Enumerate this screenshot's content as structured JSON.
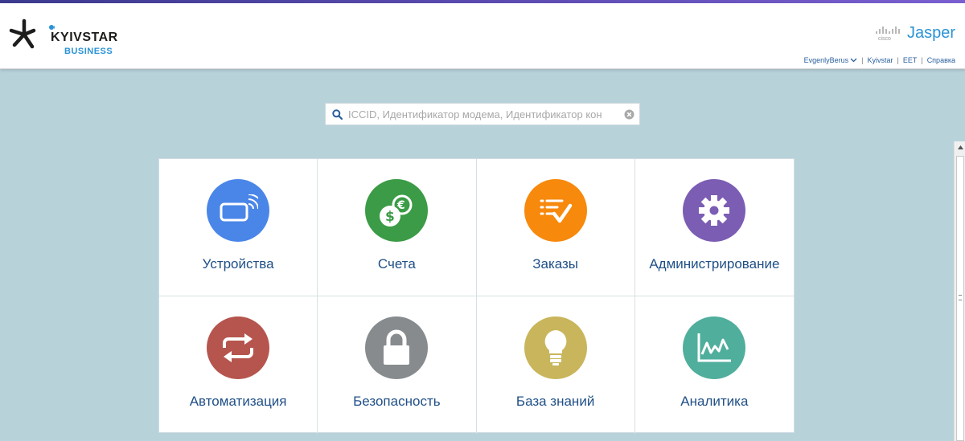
{
  "header": {
    "logo_text": "KYIVSTAR",
    "logo_sub": "BUSINESS",
    "brand_company": "cisco",
    "brand_name": "Jasper",
    "user_name": "EvgenlyBerus",
    "nav": [
      "Kyivstar",
      "EET",
      "Справка"
    ]
  },
  "search": {
    "placeholder": "ICCID, Идентификатор модема, Идентификатор кон"
  },
  "tiles": [
    {
      "label": "Устройства",
      "icon": "sim-wireless-icon",
      "color": "#4a86e8"
    },
    {
      "label": "Счета",
      "icon": "coins-icon",
      "color": "#3b9b46"
    },
    {
      "label": "Заказы",
      "icon": "checklist-icon",
      "color": "#f7890c"
    },
    {
      "label": "Администрирование",
      "icon": "gear-icon",
      "color": "#7b5db4"
    },
    {
      "label": "Автоматизация",
      "icon": "repeat-arrows-icon",
      "color": "#b5554d"
    },
    {
      "label": "Безопасность",
      "icon": "lock-icon",
      "color": "#878b8e"
    },
    {
      "label": "База знаний",
      "icon": "lightbulb-icon",
      "color": "#c9b55c"
    },
    {
      "label": "Аналитика",
      "icon": "line-chart-icon",
      "color": "#4fae9c"
    }
  ],
  "colors": {
    "background": "#b8d2da",
    "header_bg": "#ffffff",
    "link": "#2a5f9e",
    "accent": "#2a93d5"
  }
}
